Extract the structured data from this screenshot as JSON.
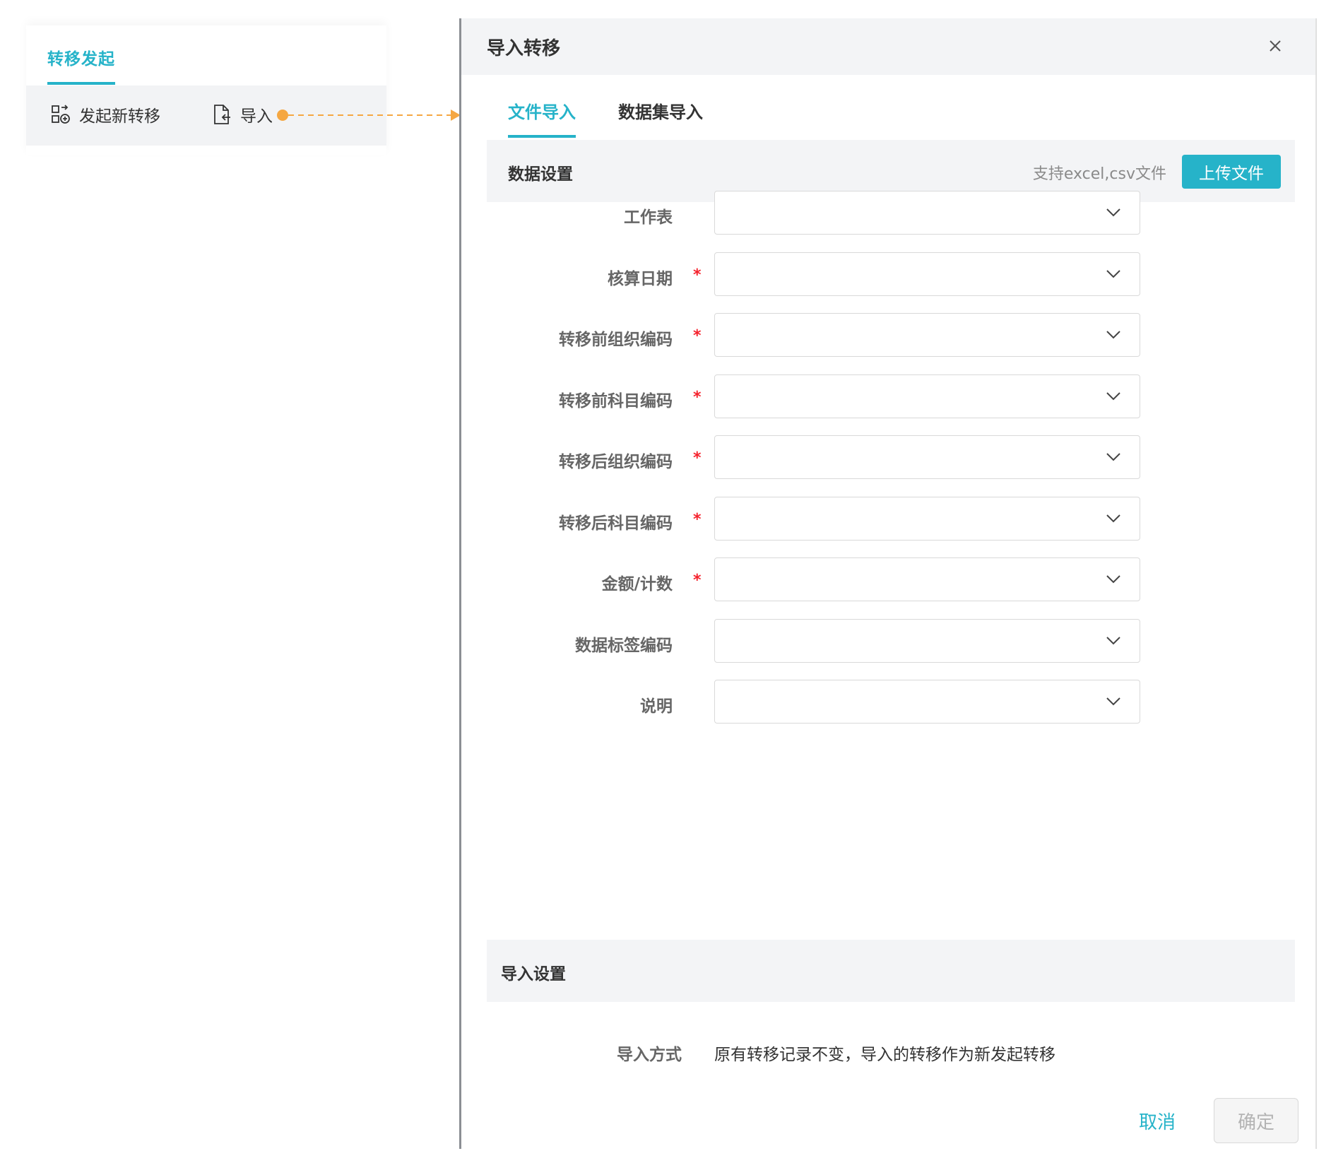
{
  "left_panel": {
    "tab_label": "转移发起",
    "toolbar": {
      "new_transfer_label": "发起新转移",
      "import_label": "导入"
    }
  },
  "dialog": {
    "title": "导入转移",
    "tabs": [
      {
        "label": "文件导入",
        "active": true
      },
      {
        "label": "数据集导入",
        "active": false
      }
    ],
    "data_section": {
      "title": "数据设置",
      "hint": "支持excel,csv文件",
      "upload_label": "上传文件"
    },
    "fields": [
      {
        "label": "工作表",
        "required": false,
        "value": ""
      },
      {
        "label": "核算日期",
        "required": true,
        "value": ""
      },
      {
        "label": "转移前组织编码",
        "required": true,
        "value": ""
      },
      {
        "label": "转移前科目编码",
        "required": true,
        "value": ""
      },
      {
        "label": "转移后组织编码",
        "required": true,
        "value": ""
      },
      {
        "label": "转移后科目编码",
        "required": true,
        "value": ""
      },
      {
        "label": "金额/计数",
        "required": true,
        "value": ""
      },
      {
        "label": "数据标签编码",
        "required": false,
        "value": ""
      },
      {
        "label": "说明",
        "required": false,
        "value": ""
      }
    ],
    "required_mark": "*",
    "import_section": {
      "title": "导入设置",
      "mode_label": "导入方式",
      "mode_value": "原有转移记录不变，导入的转移作为新发起转移"
    },
    "cancel_label": "取消",
    "confirm_label": "确定"
  },
  "colors": {
    "accent": "#26b3c9",
    "annotation": "#f5a742",
    "required": "#f5222d"
  }
}
